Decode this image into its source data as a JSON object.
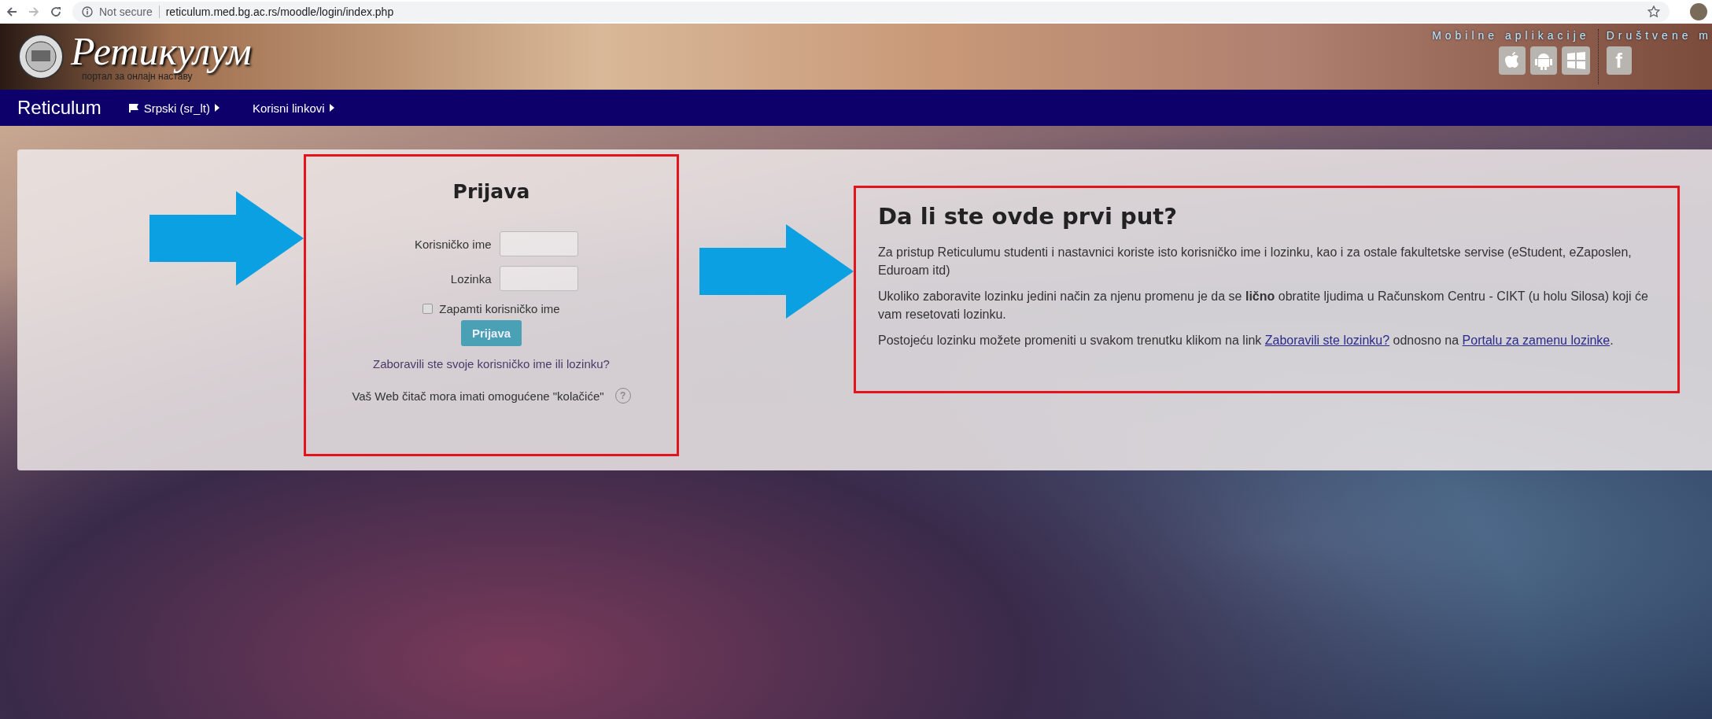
{
  "browser": {
    "security_label": "Not secure",
    "url": "reticulum.med.bg.ac.rs/moodle/login/index.php"
  },
  "header": {
    "logo_title": "Ретикулум",
    "logo_subtitle": "портал за онлајн наставу",
    "mobile_apps_label": "Mobilne aplikacije",
    "social_label": "Društvene m",
    "facebook_glyph": "f"
  },
  "nav": {
    "brand": "Reticulum",
    "items": [
      {
        "label": "Srpski (sr_lt)",
        "kind": "language"
      },
      {
        "label": "Korisni linkovi",
        "kind": "menu"
      }
    ]
  },
  "login": {
    "title": "Prijava",
    "fields": [
      {
        "label": "Korisničko ime"
      },
      {
        "label": "Lozinka"
      }
    ],
    "remember": {
      "label": "Zapamti korisničko ime",
      "checked": false
    },
    "submit": "Prijava",
    "forgot_link": "Zaboravili ste svoje korisničko ime ili lozinku?",
    "cookies_note": "Vaš Web čitač mora imati omogućene \"kolačiće\"",
    "help_glyph": "?"
  },
  "info": {
    "title": "Da li ste ovde prvi put?",
    "paragraphs": [
      [
        {
          "kind": "text",
          "text": "Za pristup Reticulumu studenti i nastavnici koriste isto korisničko ime i lozinku, kao i za ostale fakultetske servise (eStudent, eZaposlen, Eduroam itd)"
        }
      ],
      [
        {
          "kind": "text",
          "text": "Ukoliko zaboravite lozinku jedini način za njenu promenu je da se **lično** obratite ljudima u Računskom Centru - CIKT (u holu Silosa) koji će vam resetovati lozinku."
        }
      ],
      [
        {
          "kind": "text",
          "text": "Postojeću lozinku možete promeniti u svakom trenutku klikom na link "
        },
        {
          "kind": "link",
          "text": "Zaboravili ste lozinku?"
        },
        {
          "kind": "text",
          "text": " odnosno na "
        },
        {
          "kind": "link",
          "text": "Portalu za zamenu lozinke"
        },
        {
          "kind": "text",
          "text": "."
        }
      ]
    ]
  }
}
